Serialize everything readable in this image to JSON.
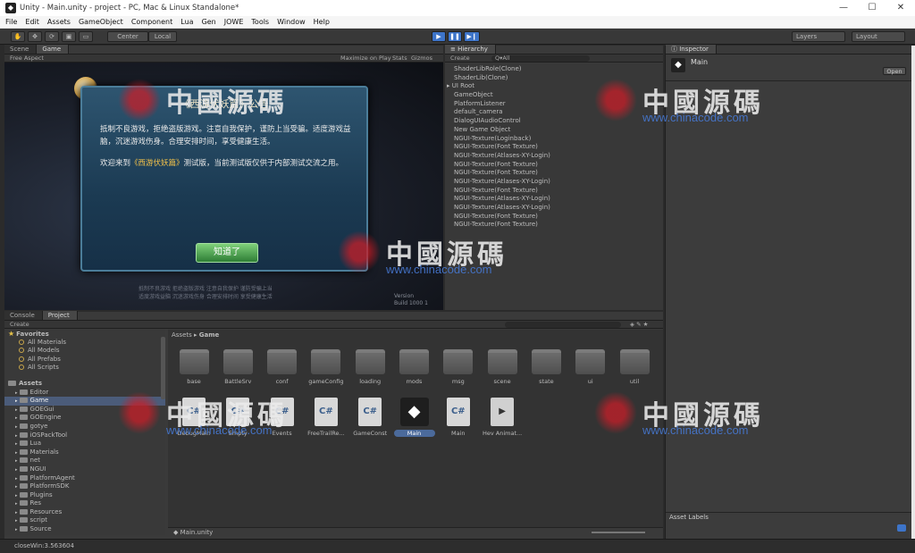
{
  "window": {
    "title": "Unity - Main.unity - project - PC, Mac & Linux Standalone*",
    "app_icon": "unity-icon",
    "controls": [
      "—",
      "☐",
      "✕"
    ]
  },
  "menubar": [
    "File",
    "Edit",
    "Assets",
    "GameObject",
    "Component",
    "Lua",
    "Gen",
    "JOWE",
    "Tools",
    "Window",
    "Help"
  ],
  "toolbar": {
    "tools": [
      "✋",
      "✥",
      "⟳",
      "▣",
      "▭"
    ],
    "pivot": "Center",
    "space": "Local",
    "play_buttons": [
      "▶",
      "❚❚",
      "▶❙"
    ],
    "layers": "Layers",
    "layout": "Layout"
  },
  "scene_tabs": [
    "Scene",
    "Game"
  ],
  "game_bar": {
    "aspect": "Free Aspect",
    "options": [
      "Maximize on Play",
      "Stats",
      "Gizmos"
    ]
  },
  "game_dialog": {
    "title": "《西游伏妖篇》公告",
    "para1": "抵制不良游戏，拒绝盗版游戏。注意自我保护，谨防上当受骗。适度游戏益脑，沉迷游戏伤身。合理安排时间，享受健康生活。",
    "para2_prefix": "欢迎来到",
    "para2_highlight": "《西游伏妖篇》",
    "para2_suffix": "测试版，当前测试版仅供于内部测试交流之用。",
    "button": "知道了",
    "footnote1": "抵制不良游戏 拒绝盗版游戏 注意自我保护 谨防受骗上当",
    "footnote2": "适度游戏益脑 沉迷游戏伤身 合理安排时间 享受健康生活",
    "version1": "Version",
    "version2": "Build 1000 1"
  },
  "hierarchy": {
    "tab": "Hierarchy",
    "create": "Create",
    "search_placeholder": "Q▾All",
    "items": [
      "ShaderLibRole(Clone)",
      "ShaderLib(Clone)",
      "UI Root",
      "GameObject",
      "PlatformListener",
      "default_camera",
      "DialogUIAudioControl",
      "New Game Object",
      "NGUI-Texture(Loginback)",
      "NGUI-Texture(Font Texture)",
      "NGUI-Texture(Atlases-XY-Login)",
      "NGUI-Texture(Font Texture)",
      "NGUI-Texture(Font Texture)",
      "NGUI-Texture(Atlases-XY-Login)",
      "NGUI-Texture(Font Texture)",
      "NGUI-Texture(Atlases-XY-Login)",
      "NGUI-Texture(Atlases-XY-Login)",
      "NGUI-Texture(Font Texture)",
      "NGUI-Texture(Font Texture)"
    ],
    "expand_index": 2
  },
  "inspector": {
    "tab": "Inspector",
    "object": "Main",
    "open_button": "Open",
    "asset_labels": "Asset Labels"
  },
  "project": {
    "tabs": [
      "Console",
      "Project"
    ],
    "create": "Create",
    "breadcrumb": [
      "Assets",
      "Game"
    ],
    "favorites_header": "Favorites",
    "favorites": [
      "All Materials",
      "All Models",
      "All Prefabs",
      "All Scripts"
    ],
    "assets_header": "Assets",
    "tree": [
      "Editor",
      "Game",
      "GOEGui",
      "GOEngine",
      "gotye",
      "iOSPackTool",
      "Lua",
      "Materials",
      "net",
      "NGUI",
      "PlatformAgent",
      "PlatformSDK",
      "Plugins",
      "Res",
      "Resources",
      "script",
      "Source"
    ],
    "tree_selected": "Game",
    "folders": [
      "base",
      "BattleSrv",
      "conf",
      "gameConfig",
      "loading",
      "mods",
      "msg",
      "scene",
      "state",
      "ui",
      "util"
    ],
    "files": [
      {
        "name": "DebugMain",
        "kind": "cs"
      },
      {
        "name": "Empty",
        "kind": "cs"
      },
      {
        "name": "Events",
        "kind": "cs"
      },
      {
        "name": "FreeTrailRe...",
        "kind": "cs"
      },
      {
        "name": "GameConst",
        "kind": "cs"
      },
      {
        "name": "Main",
        "kind": "unity"
      },
      {
        "name": "Main",
        "kind": "cs"
      },
      {
        "name": "Hev Animat...",
        "kind": "anim"
      }
    ],
    "selected_file": "Main.unity"
  },
  "status": "closeWin:3.563604",
  "watermark": {
    "cn": "中國源碼",
    "url": "www.chinacode.com"
  }
}
